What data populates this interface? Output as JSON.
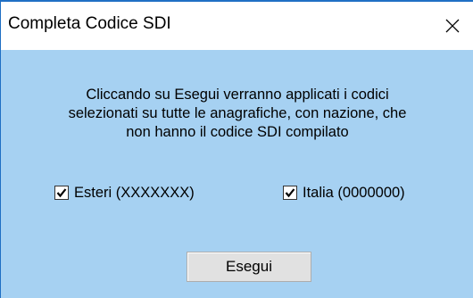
{
  "dialog": {
    "title": "Completa Codice SDI",
    "close_icon": "close-icon",
    "message_lines": [
      "Cliccando su Esegui verranno applicati i codici",
      "selezionati su tutte le anagrafiche, con nazione, che",
      "non hanno il codice SDI compilato"
    ],
    "checkboxes": [
      {
        "label": "Esteri (XXXXXXX)",
        "checked": true
      },
      {
        "label": "Italia (0000000)",
        "checked": true
      }
    ],
    "execute_button_label": "Esegui"
  },
  "colors": {
    "dialog_background": "#a6d1f2",
    "titlebar_background": "#ffffff",
    "window_border": "#1f6fc4",
    "button_background": "#e1e1e1"
  }
}
